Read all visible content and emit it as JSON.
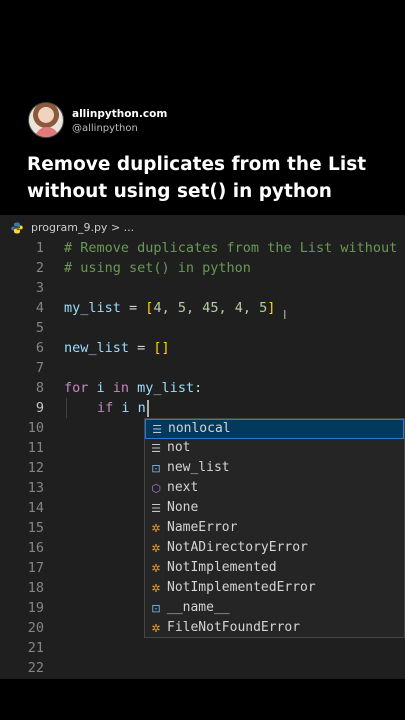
{
  "post": {
    "site": "allinpython.com",
    "handle": "@allinpython",
    "title": "Remove duplicates from the List without using set() in python"
  },
  "editor": {
    "tab": "program_9.py > ...",
    "line_numbers": [
      "1",
      "2",
      "3",
      "4",
      "5",
      "6",
      "7",
      "8",
      "9",
      "10",
      "11",
      "12",
      "13",
      "14",
      "15",
      "16",
      "17",
      "18",
      "19",
      "20",
      "21",
      "22"
    ],
    "code": {
      "line1": "# Remove duplicates from the List without",
      "line2": "# using set() in python",
      "line4_var": "my_list",
      "line4_eq": " = ",
      "line4_open": "[",
      "line4_nums": "4, 5, 45, 4, 5",
      "line4_close": "]",
      "line6_var": "new_list",
      "line6_eq": " = ",
      "line6_brackets": "[]",
      "line8_for": "for",
      "line8_i": " i ",
      "line8_in": "in",
      "line8_list": " my_list",
      "line8_colon": ":",
      "line9_if": "if",
      "line9_rest": " i n"
    }
  },
  "suggestions": [
    {
      "icon": "keyword-icon",
      "glyph": "☰",
      "kind": "kw",
      "label": "nonlocal"
    },
    {
      "icon": "keyword-icon",
      "glyph": "☰",
      "kind": "kw",
      "label": "not"
    },
    {
      "icon": "variable-icon",
      "glyph": "⊡",
      "kind": "var",
      "label": "new_list"
    },
    {
      "icon": "module-icon",
      "glyph": "⬡",
      "kind": "mod",
      "label": "next"
    },
    {
      "icon": "keyword-icon",
      "glyph": "☰",
      "kind": "kw",
      "label": "None"
    },
    {
      "icon": "class-icon",
      "glyph": "✲",
      "kind": "cls",
      "label": "NameError"
    },
    {
      "icon": "class-icon",
      "glyph": "✲",
      "kind": "cls",
      "label": "NotADirectoryError"
    },
    {
      "icon": "class-icon",
      "glyph": "✲",
      "kind": "cls",
      "label": "NotImplemented"
    },
    {
      "icon": "class-icon",
      "glyph": "✲",
      "kind": "cls",
      "label": "NotImplementedError"
    },
    {
      "icon": "variable-icon",
      "glyph": "⊡",
      "kind": "var",
      "label": "__name__"
    },
    {
      "icon": "class-icon",
      "glyph": "✲",
      "kind": "cls",
      "label": "FileNotFoundError"
    }
  ],
  "colors": {
    "editor_bg": "#1f1f1f",
    "comment": "#6a9955",
    "keyword": "#c586c0",
    "variable": "#9cdcfe",
    "number": "#b5cea8",
    "selection": "#04395e"
  }
}
